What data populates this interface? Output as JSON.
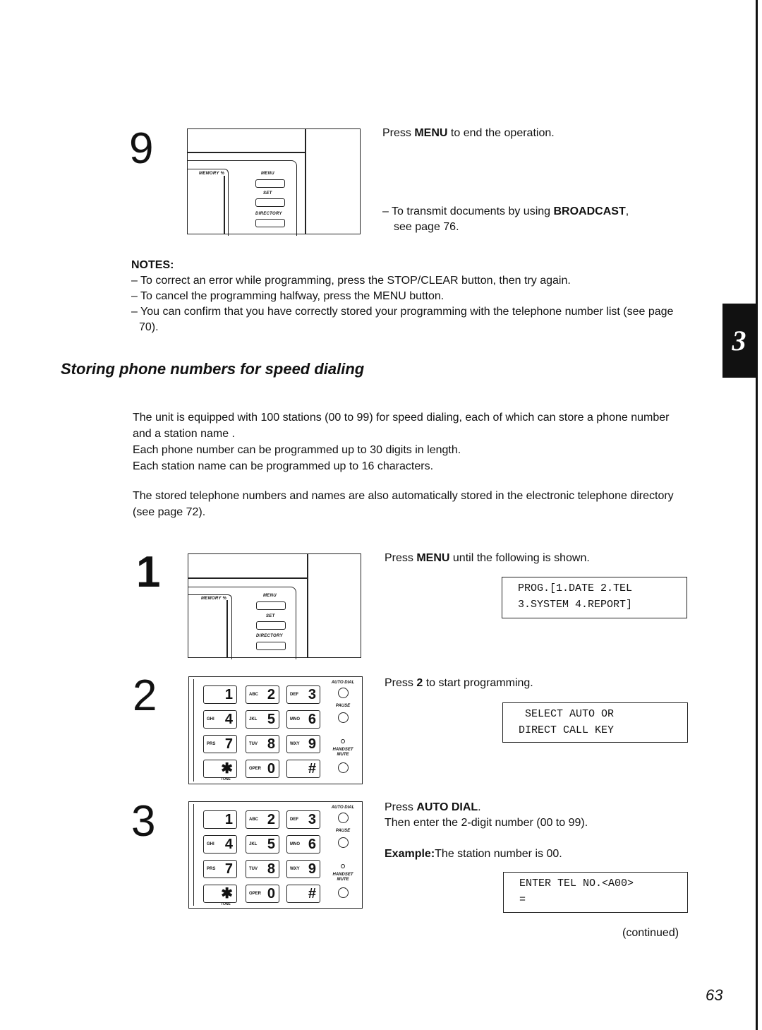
{
  "chapter_tab": "3",
  "page_number": "63",
  "continued": "(continued)",
  "panel_labels": {
    "memory": "MEMORY %",
    "menu": "MENU",
    "set": "SET",
    "directory": "DIRECTORY"
  },
  "keypad": {
    "keys": [
      {
        "sub": "",
        "digit": "1"
      },
      {
        "sub": "ABC",
        "digit": "2"
      },
      {
        "sub": "DEF",
        "digit": "3"
      },
      {
        "sub": "GHI",
        "digit": "4"
      },
      {
        "sub": "JKL",
        "digit": "5"
      },
      {
        "sub": "MNO",
        "digit": "6"
      },
      {
        "sub": "PRS",
        "digit": "7"
      },
      {
        "sub": "TUV",
        "digit": "8"
      },
      {
        "sub": "WXY",
        "digit": "9"
      },
      {
        "sub": "",
        "digit": "✱"
      },
      {
        "sub": "OPER",
        "digit": "0"
      },
      {
        "sub": "",
        "digit": "#"
      }
    ],
    "auto_dial": "AUTO DIAL",
    "pause": "PAUSE",
    "handset_mute": "HANDSET MUTE",
    "tone": "TONE"
  },
  "step9": {
    "number": "9",
    "text_prefix": "Press ",
    "text_bold": "MENU",
    "text_suffix": " to end the operation.",
    "note_prefix": "– To transmit documents by using ",
    "note_bold": "BROADCAST",
    "note_suffix": ",",
    "note_line2": "see page 76."
  },
  "notes": {
    "heading": "NOTES:",
    "items": [
      "– To correct an error while programming, press the STOP/CLEAR button, then try again.",
      "– To cancel the programming halfway, press the MENU button.",
      "– You can confirm that you have correctly stored your programming with the telephone number list (see page 70)."
    ]
  },
  "section": {
    "title": "Storing phone numbers for speed dialing",
    "paragraph1": [
      "The unit is equipped with 100 stations (00 to 99) for speed dialing, each of which can store a phone number and a station name .",
      "Each phone number can be programmed up to 30 digits in length.",
      "Each station name can be programmed up to 16 characters."
    ],
    "paragraph2": "The stored telephone numbers and names are also automatically stored in the electronic telephone directory (see page 72)."
  },
  "step1": {
    "number": "1",
    "text_prefix": "Press ",
    "text_bold": "MENU",
    "text_suffix": " until the following is shown.",
    "lcd_line1": "PROG.[1.DATE 2.TEL",
    "lcd_line2": "3.SYSTEM 4.REPORT]"
  },
  "step2": {
    "number": "2",
    "text_prefix": "Press ",
    "text_bold": "2",
    "text_suffix": " to start programming.",
    "lcd_line1": " SELECT AUTO OR",
    "lcd_line2": "DIRECT CALL KEY"
  },
  "step3": {
    "number": "3",
    "text_prefix": "Press ",
    "text_bold": "AUTO DIAL",
    "text_suffix": ".",
    "line2": "Then enter the 2-digit number (00 to 99).",
    "example_bold": "Example:",
    "example_text": "The station number is 00.",
    "lcd_line1": "ENTER TEL NO.<A00>",
    "lcd_line2": "="
  }
}
